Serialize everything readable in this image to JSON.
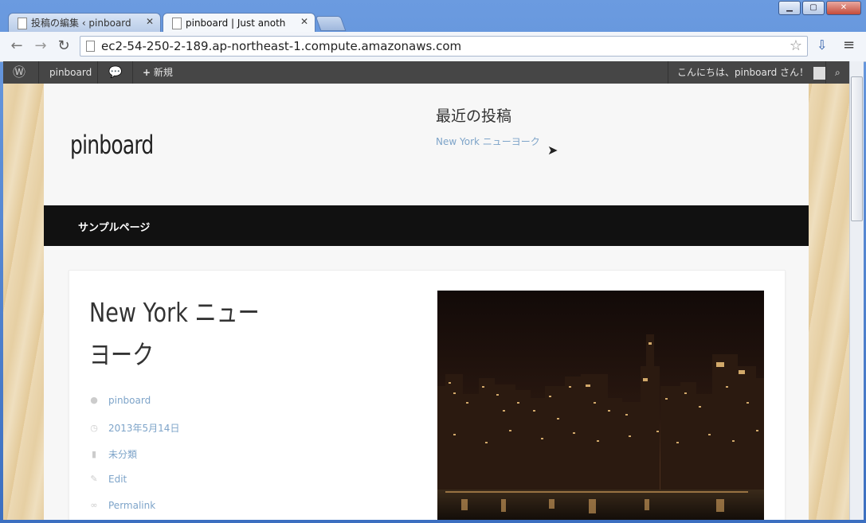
{
  "browser": {
    "tabs": [
      {
        "label": "投稿の編集 ‹ pinboard —",
        "active": false
      },
      {
        "label": "pinboard | Just another",
        "active": true
      }
    ],
    "url": "ec2-54-250-2-189.ap-northeast-1.compute.amazonaws.com",
    "window_buttons": [
      "minimize",
      "maximize",
      "close"
    ]
  },
  "admin_bar": {
    "site_name": "pinboard",
    "new_label": "新規",
    "greeting": "こんにちは、pinboard さん！"
  },
  "site": {
    "title": "pinboard",
    "recent_heading": "最近の投稿",
    "recent_link": "New York ニューヨーク",
    "menu_item": "サンプルページ"
  },
  "post": {
    "title": "New York ニューヨーク",
    "meta": {
      "author": "pinboard",
      "date": "2013年5月14日",
      "category": "未分類",
      "edit": "Edit",
      "permalink": "Permalink"
    }
  },
  "colors": {
    "link": "#7ea4c9",
    "menubar": "#111111",
    "adminbar": "#464646"
  }
}
